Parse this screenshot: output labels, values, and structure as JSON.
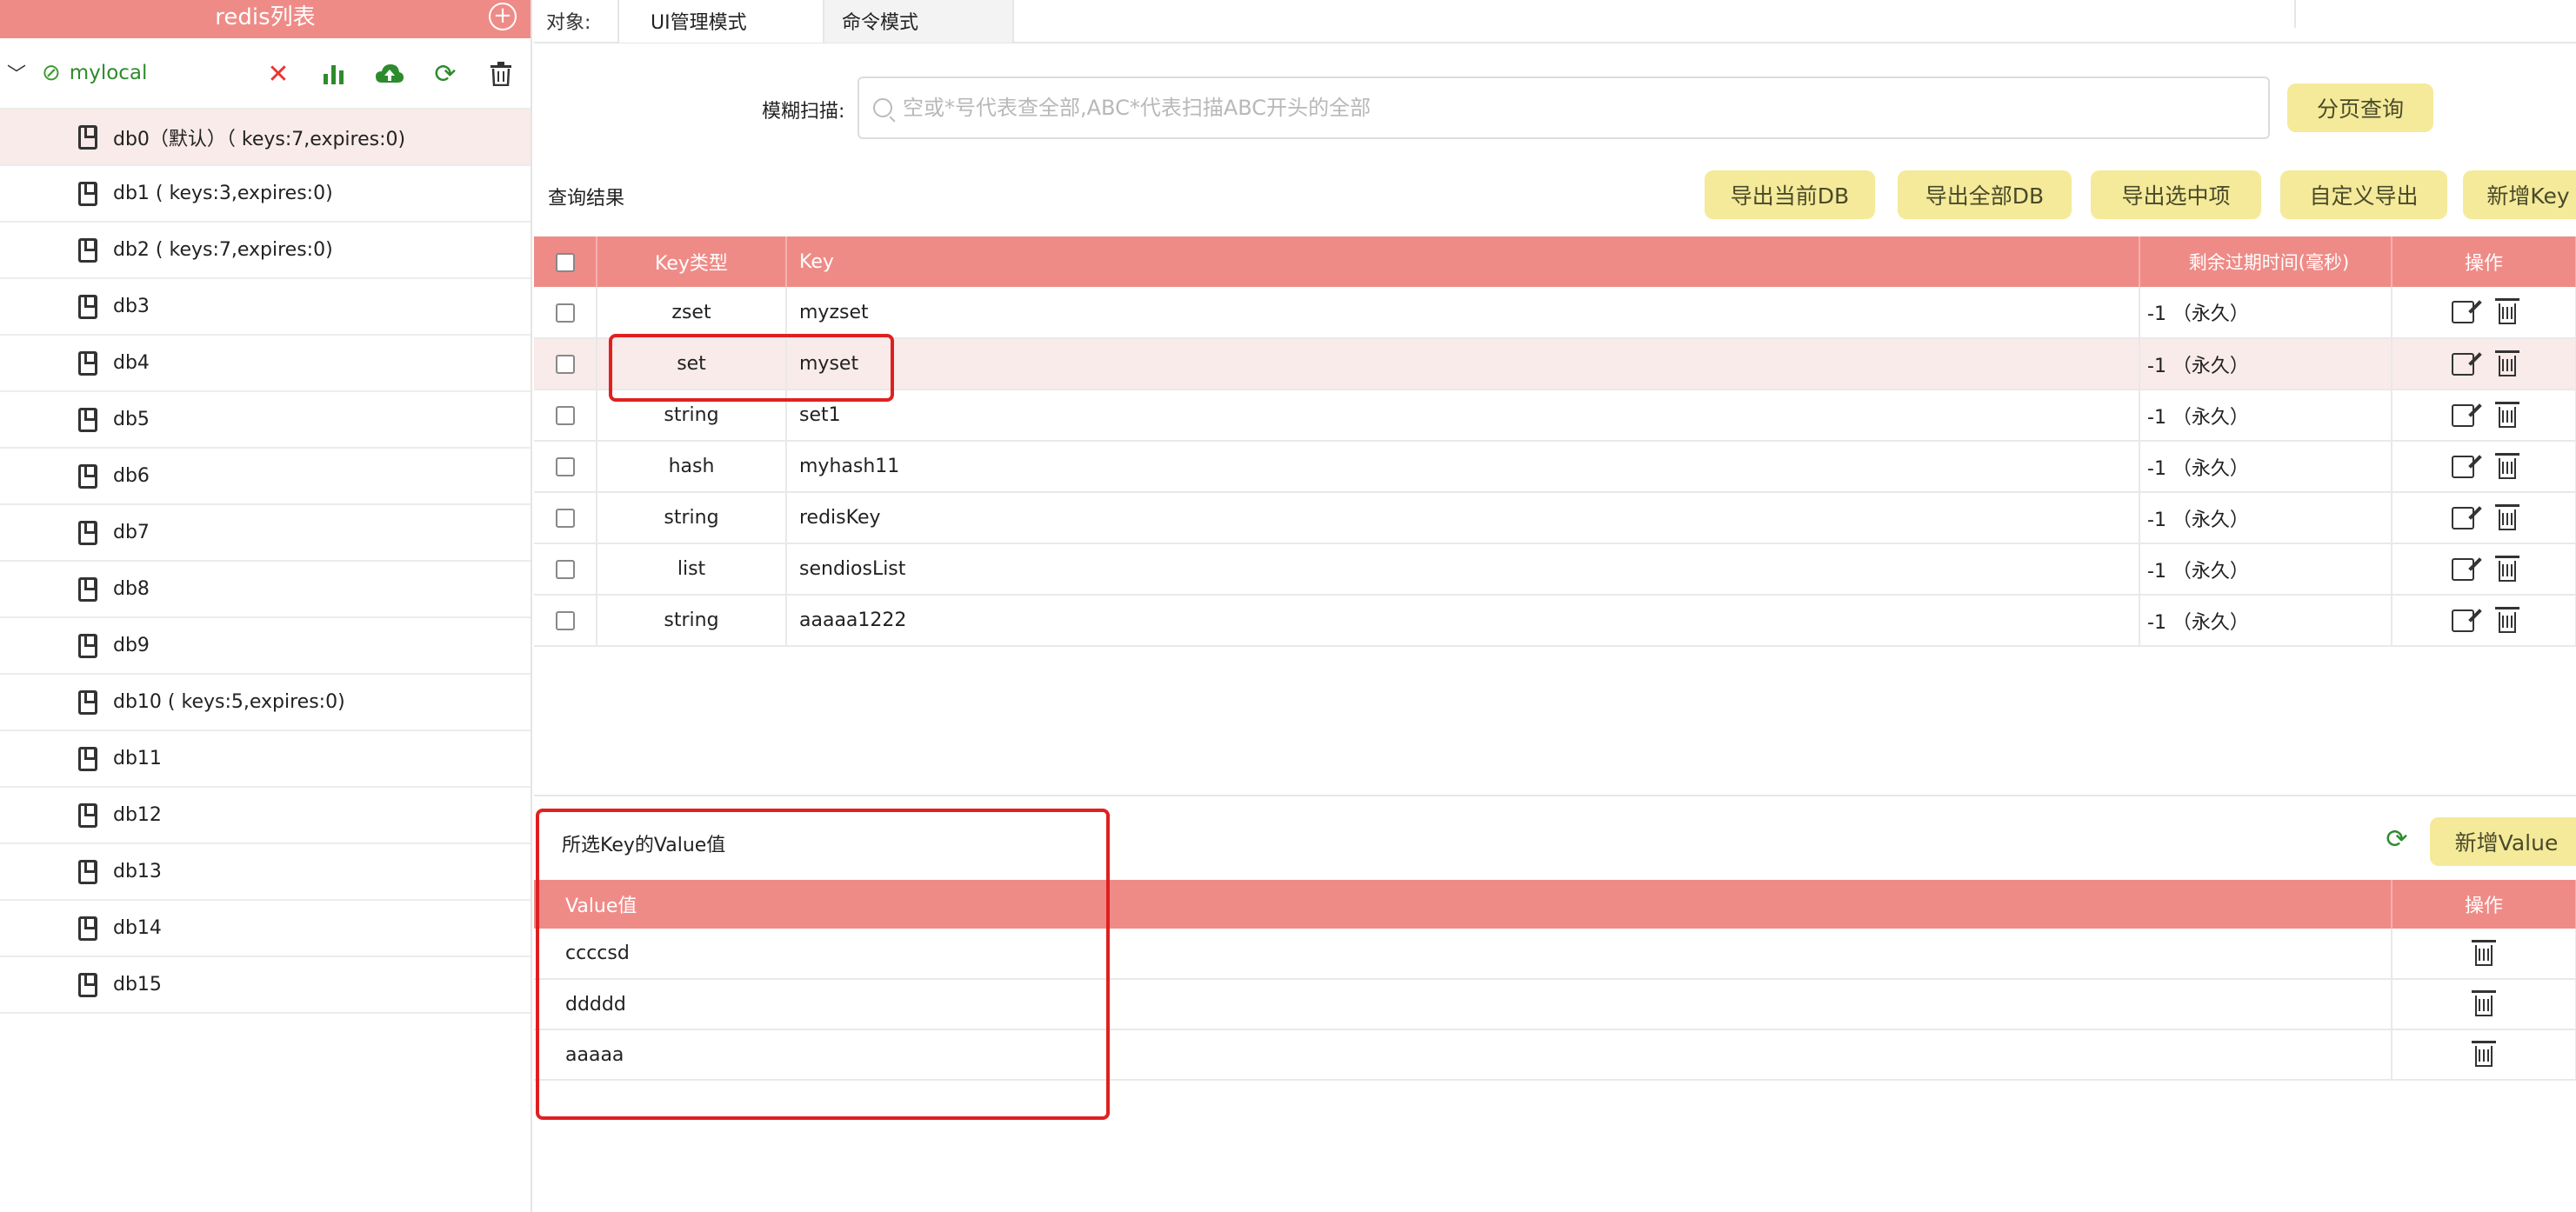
{
  "sidebar": {
    "title": "redis列表",
    "add_icon": "plus-circle-icon",
    "connection": {
      "name": "mylocal",
      "expand_icon": "chevron-down-icon",
      "link_icon": "link-icon",
      "tools": [
        "close-icon",
        "bar-chart-icon",
        "cloud-upload-icon",
        "refresh-icon",
        "trash-icon"
      ]
    },
    "dbs": [
      {
        "label": "db0（默认）（ keys:7,expires:0)",
        "active": true
      },
      {
        "label": "db1 ( keys:3,expires:0)"
      },
      {
        "label": "db2 ( keys:7,expires:0)"
      },
      {
        "label": "db3"
      },
      {
        "label": "db4"
      },
      {
        "label": "db5"
      },
      {
        "label": "db6"
      },
      {
        "label": "db7"
      },
      {
        "label": "db8"
      },
      {
        "label": "db9"
      },
      {
        "label": "db10 ( keys:5,expires:0)"
      },
      {
        "label": "db11"
      },
      {
        "label": "db12"
      },
      {
        "label": "db13"
      },
      {
        "label": "db14"
      },
      {
        "label": "db15"
      }
    ]
  },
  "tabs": {
    "label": "对象:",
    "ui_mode": "UI管理模式",
    "cmd_mode": "命令模式"
  },
  "search": {
    "label": "模糊扫描:",
    "placeholder": "空或*号代表查全部,ABC*代表扫描ABC开头的全部",
    "value": "",
    "page_query": "分页查询"
  },
  "results": {
    "title": "查询结果",
    "buttons": {
      "export_current": "导出当前DB",
      "export_all": "导出全部DB",
      "export_selected": "导出选中项",
      "custom_export": "自定义导出",
      "new_key": "新增Key"
    },
    "headers": {
      "type": "Key类型",
      "key": "Key",
      "ttl": "剩余过期时间(毫秒)",
      "ops": "操作"
    },
    "rows": [
      {
        "type": "zset",
        "key": "myzset",
        "ttl": "-1 （永久）"
      },
      {
        "type": "set",
        "key": "myset",
        "ttl": "-1 （永久）",
        "selected": true
      },
      {
        "type": "string",
        "key": "set1",
        "ttl": "-1 （永久）"
      },
      {
        "type": "hash",
        "key": "myhash11",
        "ttl": "-1 （永久）"
      },
      {
        "type": "string",
        "key": "redisKey",
        "ttl": "-1 （永久）"
      },
      {
        "type": "list",
        "key": "sendiosList",
        "ttl": "-1 （永久）"
      },
      {
        "type": "string",
        "key": "aaaaa1222",
        "ttl": "-1 （永久）"
      }
    ]
  },
  "values": {
    "title": "所选Key的Value值",
    "new_value": "新增Value",
    "headers": {
      "value": "Value值",
      "ops": "操作"
    },
    "rows": [
      {
        "value": "ccccsd"
      },
      {
        "value": "ddddd"
      },
      {
        "value": "aaaaa"
      }
    ]
  },
  "colors": {
    "header_bg": "#ef8b87",
    "button_bg": "#f4ea9a",
    "selected_row": "#f9ebe9",
    "highlight": "#e02020",
    "accent_green": "#2e8b2c"
  }
}
